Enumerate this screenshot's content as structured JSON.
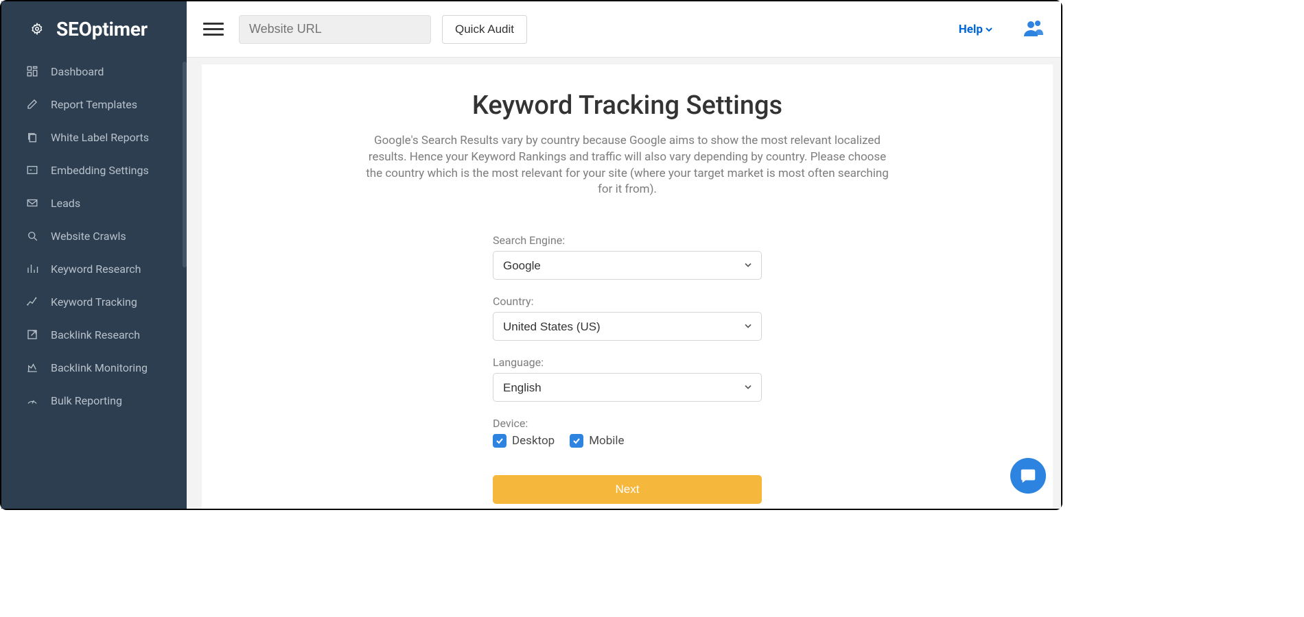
{
  "brand": "SEOptimer",
  "topbar": {
    "url_placeholder": "Website URL",
    "quick_audit": "Quick Audit",
    "help": "Help"
  },
  "sidebar": {
    "items": [
      {
        "icon": "dashboard",
        "label": "Dashboard"
      },
      {
        "icon": "edit",
        "label": "Report Templates"
      },
      {
        "icon": "copy",
        "label": "White Label Reports"
      },
      {
        "icon": "embed",
        "label": "Embedding Settings"
      },
      {
        "icon": "mail",
        "label": "Leads"
      },
      {
        "icon": "search",
        "label": "Website Crawls"
      },
      {
        "icon": "bar",
        "label": "Keyword Research"
      },
      {
        "icon": "line",
        "label": "Keyword Tracking"
      },
      {
        "icon": "external",
        "label": "Backlink Research"
      },
      {
        "icon": "chart",
        "label": "Backlink Monitoring"
      },
      {
        "icon": "gauge",
        "label": "Bulk Reporting"
      }
    ]
  },
  "page": {
    "title": "Keyword Tracking Settings",
    "description": "Google's Search Results vary by country because Google aims to show the most relevant localized results. Hence your Keyword Rankings and traffic will also vary depending by country. Please choose the country which is the most relevant for your site (where your target market is most often searching for it from).",
    "form": {
      "search_engine_label": "Search Engine:",
      "search_engine_value": "Google",
      "country_label": "Country:",
      "country_value": "United States (US)",
      "language_label": "Language:",
      "language_value": "English",
      "device_label": "Device:",
      "device_desktop": "Desktop",
      "device_mobile": "Mobile",
      "next": "Next"
    }
  }
}
